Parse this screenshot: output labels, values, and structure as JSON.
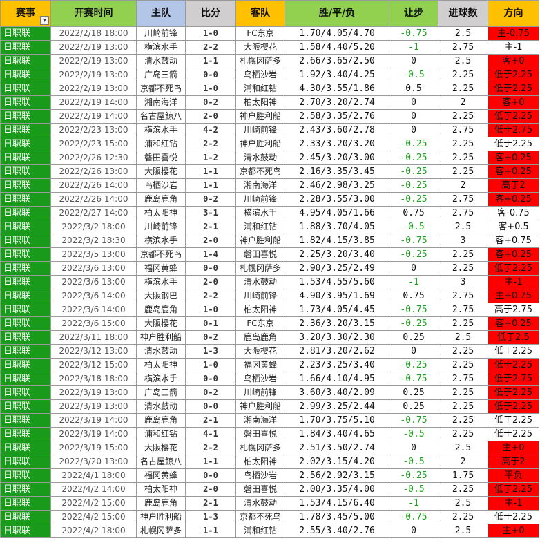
{
  "headers": [
    "赛事",
    "开赛时间",
    "主队",
    "比分",
    "客队",
    "胜/平/负",
    "让步",
    "进球数",
    "方向"
  ],
  "rows": [
    {
      "league": "日职联",
      "time": "2022/2/18 18:00",
      "home": "川崎前锋",
      "score": "1-0",
      "away": "FC东京",
      "odds": "1.70/4.05/4.70",
      "hcp": "-0.75",
      "goals": "2.5",
      "dir": "主-0.75",
      "dir_color": "red"
    },
    {
      "league": "日职联",
      "time": "2022/2/19 13:00",
      "home": "横滨水手",
      "score": "2-2",
      "away": "大阪樱花",
      "odds": "1.58/4.40/5.20",
      "hcp": "-1",
      "goals": "2.75",
      "dir": "主-1",
      "dir_color": "white"
    },
    {
      "league": "日职联",
      "time": "2022/2/19 13:00",
      "home": "清水鼓动",
      "score": "1-1",
      "away": "札幌冈萨多",
      "odds": "2.66/3.65/2.50",
      "hcp": "0",
      "goals": "2.5",
      "dir": "客+0",
      "dir_color": "red"
    },
    {
      "league": "日职联",
      "time": "2022/2/19 13:00",
      "home": "广岛三箭",
      "score": "0-0",
      "away": "鸟栖沙岩",
      "odds": "1.92/3.40/4.25",
      "hcp": "-0.5",
      "goals": "2.25",
      "dir": "低于2.25",
      "dir_color": "red"
    },
    {
      "league": "日职联",
      "time": "2022/2/19 13:00",
      "home": "京都不死鸟",
      "score": "1-0",
      "away": "浦和红钻",
      "odds": "4.30/3.55/1.86",
      "hcp": "0.5",
      "goals": "2.25",
      "dir": "低于2.25",
      "dir_color": "red"
    },
    {
      "league": "日职联",
      "time": "2022/2/19 14:00",
      "home": "湘南海洋",
      "score": "0-2",
      "away": "柏太阳神",
      "odds": "2.70/3.20/2.74",
      "hcp": "0",
      "goals": "2",
      "dir": "客+0",
      "dir_color": "red"
    },
    {
      "league": "日职联",
      "time": "2022/2/19 14:00",
      "home": "名古屋鲸八",
      "score": "2-0",
      "away": "神户胜利船",
      "odds": "2.58/3.35/2.76",
      "hcp": "0",
      "goals": "2.25",
      "dir": "低于2.25",
      "dir_color": "red"
    },
    {
      "league": "日职联",
      "time": "2022/2/23 13:00",
      "home": "横滨水手",
      "score": "4-2",
      "away": "川崎前锋",
      "odds": "2.43/3.60/2.78",
      "hcp": "0",
      "goals": "2.75",
      "dir": "低于2.75",
      "dir_color": "red"
    },
    {
      "league": "日职联",
      "time": "2022/2/23 15:00",
      "home": "浦和红钻",
      "score": "2-2",
      "away": "神户胜利船",
      "odds": "2.33/3.20/3.20",
      "hcp": "-0.25",
      "goals": "2.25",
      "dir": "低于2.25",
      "dir_color": "white"
    },
    {
      "league": "日职联",
      "time": "2022/2/26 12:30",
      "home": "磐田喜悦",
      "score": "1-2",
      "away": "清水鼓动",
      "odds": "2.45/3.20/3.00",
      "hcp": "-0.25",
      "goals": "2.25",
      "dir": "客+0.25",
      "dir_color": "red"
    },
    {
      "league": "日职联",
      "time": "2022/2/26 13:00",
      "home": "大阪樱花",
      "score": "1-1",
      "away": "京都不死鸟",
      "odds": "2.16/3.35/3.45",
      "hcp": "-0.25",
      "goals": "2.25",
      "dir": "客+0.25",
      "dir_color": "red"
    },
    {
      "league": "日职联",
      "time": "2022/2/26 14:00",
      "home": "鸟栖沙岩",
      "score": "1-1",
      "away": "湘南海洋",
      "odds": "2.46/2.98/3.25",
      "hcp": "-0.25",
      "goals": "2",
      "dir": "高于2",
      "dir_color": "red"
    },
    {
      "league": "日职联",
      "time": "2022/2/26 14:00",
      "home": "鹿岛鹿角",
      "score": "0-2",
      "away": "川崎前锋",
      "odds": "2.28/3.55/3.00",
      "hcp": "-0.25",
      "goals": "2.75",
      "dir": "客+0.25",
      "dir_color": "red"
    },
    {
      "league": "日职联",
      "time": "2022/2/27 14:00",
      "home": "柏太阳神",
      "score": "3-1",
      "away": "横滨水手",
      "odds": "4.95/4.05/1.66",
      "hcp": "0.75",
      "goals": "2.75",
      "dir": "客-0.75",
      "dir_color": "white"
    },
    {
      "league": "日职联",
      "time": "2022/3/2 18:00",
      "home": "川崎前锋",
      "score": "2-1",
      "away": "浦和红钻",
      "odds": "1.88/3.70/4.05",
      "hcp": "-0.5",
      "goals": "2.5",
      "dir": "客+0.5",
      "dir_color": "white"
    },
    {
      "league": "日职联",
      "time": "2022/3/2 18:30",
      "home": "横滨水手",
      "score": "2-0",
      "away": "神户胜利船",
      "odds": "1.82/4.15/3.85",
      "hcp": "-0.75",
      "goals": "3",
      "dir": "客+0.75",
      "dir_color": "white"
    },
    {
      "league": "日职联",
      "time": "2022/3/5 13:00",
      "home": "京都不死鸟",
      "score": "1-4",
      "away": "磐田喜悦",
      "odds": "2.25/3.20/3.40",
      "hcp": "-0.25",
      "goals": "2.25",
      "dir": "客+0.25",
      "dir_color": "red"
    },
    {
      "league": "日职联",
      "time": "2022/3/6 13:00",
      "home": "福冈黄蜂",
      "score": "0-0",
      "away": "札幌冈萨多",
      "odds": "2.90/3.25/2.49",
      "hcp": "0",
      "goals": "2.25",
      "dir": "低于2.25",
      "dir_color": "red"
    },
    {
      "league": "日职联",
      "time": "2022/3/6 13:00",
      "home": "横滨水手",
      "score": "2-0",
      "away": "清水鼓动",
      "odds": "1.53/4.55/5.60",
      "hcp": "-1",
      "goals": "3",
      "dir": "主-1",
      "dir_color": "red"
    },
    {
      "league": "日职联",
      "time": "2022/3/6 14:00",
      "home": "大阪钢巴",
      "score": "2-2",
      "away": "川崎前锋",
      "odds": "4.90/3.95/1.69",
      "hcp": "0.75",
      "goals": "2.75",
      "dir": "主+0.75",
      "dir_color": "red"
    },
    {
      "league": "日职联",
      "time": "2022/3/6 14:00",
      "home": "鹿岛鹿角",
      "score": "1-0",
      "away": "柏太阳神",
      "odds": "1.73/4.05/4.45",
      "hcp": "-0.75",
      "goals": "2.75",
      "dir": "高于2.75",
      "dir_color": "white"
    },
    {
      "league": "日职联",
      "time": "2022/3/6 15:00",
      "home": "大阪樱花",
      "score": "0-1",
      "away": "FC东京",
      "odds": "2.36/3.20/3.15",
      "hcp": "-0.25",
      "goals": "2.25",
      "dir": "客+0.25",
      "dir_color": "red"
    },
    {
      "league": "日职联",
      "time": "2022/3/11 18:00",
      "home": "神户胜利船",
      "score": "0-2",
      "away": "鹿岛鹿角",
      "odds": "3.20/3.30/2.30",
      "hcp": "0.25",
      "goals": "2.5",
      "dir": "低于2.5",
      "dir_color": "red"
    },
    {
      "league": "日职联",
      "time": "2022/3/12 13:00",
      "home": "清水鼓动",
      "score": "1-3",
      "away": "大阪樱花",
      "odds": "2.81/3.20/2.62",
      "hcp": "0",
      "goals": "2.25",
      "dir": "低于2.25",
      "dir_color": "white"
    },
    {
      "league": "日职联",
      "time": "2022/3/12 15:00",
      "home": "柏太阳神",
      "score": "1-0",
      "away": "福冈黄蜂",
      "odds": "2.23/3.25/3.40",
      "hcp": "-0.25",
      "goals": "2.25",
      "dir": "低于2.25",
      "dir_color": "red"
    },
    {
      "league": "日职联",
      "time": "2022/3/18 18:00",
      "home": "横滨水手",
      "score": "0-0",
      "away": "鸟栖沙岩",
      "odds": "1.66/4.10/4.95",
      "hcp": "-0.75",
      "goals": "2.75",
      "dir": "低于2.75",
      "dir_color": "red"
    },
    {
      "league": "日职联",
      "time": "2022/3/19 13:00",
      "home": "广岛三箭",
      "score": "0-2",
      "away": "川崎前锋",
      "odds": "3.60/3.40/2.09",
      "hcp": "0.25",
      "goals": "2.25",
      "dir": "低于2.25",
      "dir_color": "red"
    },
    {
      "league": "日职联",
      "time": "2022/3/19 13:00",
      "home": "清水鼓动",
      "score": "0-0",
      "away": "神户胜利船",
      "odds": "2.99/3.25/2.44",
      "hcp": "0.25",
      "goals": "2.25",
      "dir": "低于2.25",
      "dir_color": "red"
    },
    {
      "league": "日职联",
      "time": "2022/3/19 14:00",
      "home": "鹿岛鹿角",
      "score": "2-1",
      "away": "湘南海洋",
      "odds": "1.70/3.75/5.10",
      "hcp": "-0.75",
      "goals": "2.25",
      "dir": "低于2.25",
      "dir_color": "white"
    },
    {
      "league": "日职联",
      "time": "2022/3/19 14:00",
      "home": "浦和红钻",
      "score": "4-1",
      "away": "磐田喜悦",
      "odds": "1.84/3.40/4.65",
      "hcp": "-0.5",
      "goals": "2.25",
      "dir": "低于2.25",
      "dir_color": "white"
    },
    {
      "league": "日职联",
      "time": "2022/3/19 15:00",
      "home": "大阪樱花",
      "score": "2-2",
      "away": "札幌冈萨多",
      "odds": "2.51/3.50/2.74",
      "hcp": "0",
      "goals": "2.5",
      "dir": "主+0",
      "dir_color": "red"
    },
    {
      "league": "日职联",
      "time": "2022/3/20 13:00",
      "home": "名古屋鲸八",
      "score": "1-1",
      "away": "柏太阳神",
      "odds": "2.02/3.15/4.20",
      "hcp": "-0.5",
      "goals": "2",
      "dir": "高于2",
      "dir_color": "red"
    },
    {
      "league": "日职联",
      "time": "2022/4/1 18:00",
      "home": "福冈黄蜂",
      "score": "0-0",
      "away": "鸟栖沙岩",
      "odds": "2.56/2.92/3.15",
      "hcp": "-0.25",
      "goals": "1.75",
      "dir": "平负",
      "dir_color": "red"
    },
    {
      "league": "日职联",
      "time": "2022/4/2 14:00",
      "home": "柏太阳神",
      "score": "2-0",
      "away": "磐田喜悦",
      "odds": "2.00/3.35/4.00",
      "hcp": "-0.5",
      "goals": "2.25",
      "dir": "低于2.25",
      "dir_color": "red"
    },
    {
      "league": "日职联",
      "time": "2022/4/2 15:00",
      "home": "鹿岛鹿角",
      "score": "2-1",
      "away": "清水鼓动",
      "odds": "1.53/4.15/6.40",
      "hcp": "-1",
      "goals": "2.5",
      "dir": "主-1",
      "dir_color": "red"
    },
    {
      "league": "日职联",
      "time": "2022/4/2 15:00",
      "home": "神户胜利船",
      "score": "1-3",
      "away": "京都不死鸟",
      "odds": "1.78/3.45/5.00",
      "hcp": "-0.75",
      "goals": "2.25",
      "dir": "低于2.25",
      "dir_color": "white"
    },
    {
      "league": "日职联",
      "time": "2022/4/2 18:00",
      "home": "札幌冈萨多",
      "score": "1-1",
      "away": "浦和红钻",
      "odds": "2.55/3.40/2.76",
      "hcp": "0",
      "goals": "2.5",
      "dir": "主+0",
      "dir_color": "red"
    }
  ],
  "colors": {
    "league_bg": "#1a9a1a",
    "dir_red": "#ff0000",
    "hcp_negative": "#1ea01e",
    "header_yellow": "#ffc000",
    "header_green": "#92d050",
    "header_blue": "#b4c6e7",
    "header_grey": "#d0cece"
  },
  "icons": {
    "filter": "filter-dropdown-icon"
  }
}
